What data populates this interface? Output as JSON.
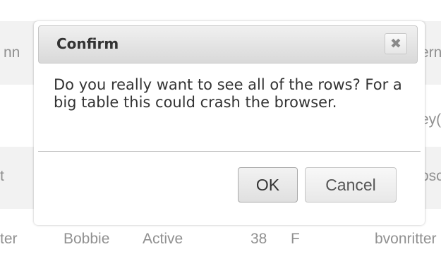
{
  "table": {
    "rows": [
      {
        "cells": [
          "nn",
          "ern"
        ]
      },
      {
        "cells": [
          "ey("
        ]
      },
      {
        "cells": [
          "t",
          "osc"
        ]
      },
      {
        "cells": [
          "ter",
          "Bobbie",
          "Active",
          "38",
          "F",
          "bvonritter"
        ]
      }
    ]
  },
  "dialog": {
    "title": "Confirm",
    "close_label": "✖",
    "message": "Do you really want to see all of the rows? For a big table this could crash the browser.",
    "ok_label": "OK",
    "cancel_label": "Cancel"
  }
}
